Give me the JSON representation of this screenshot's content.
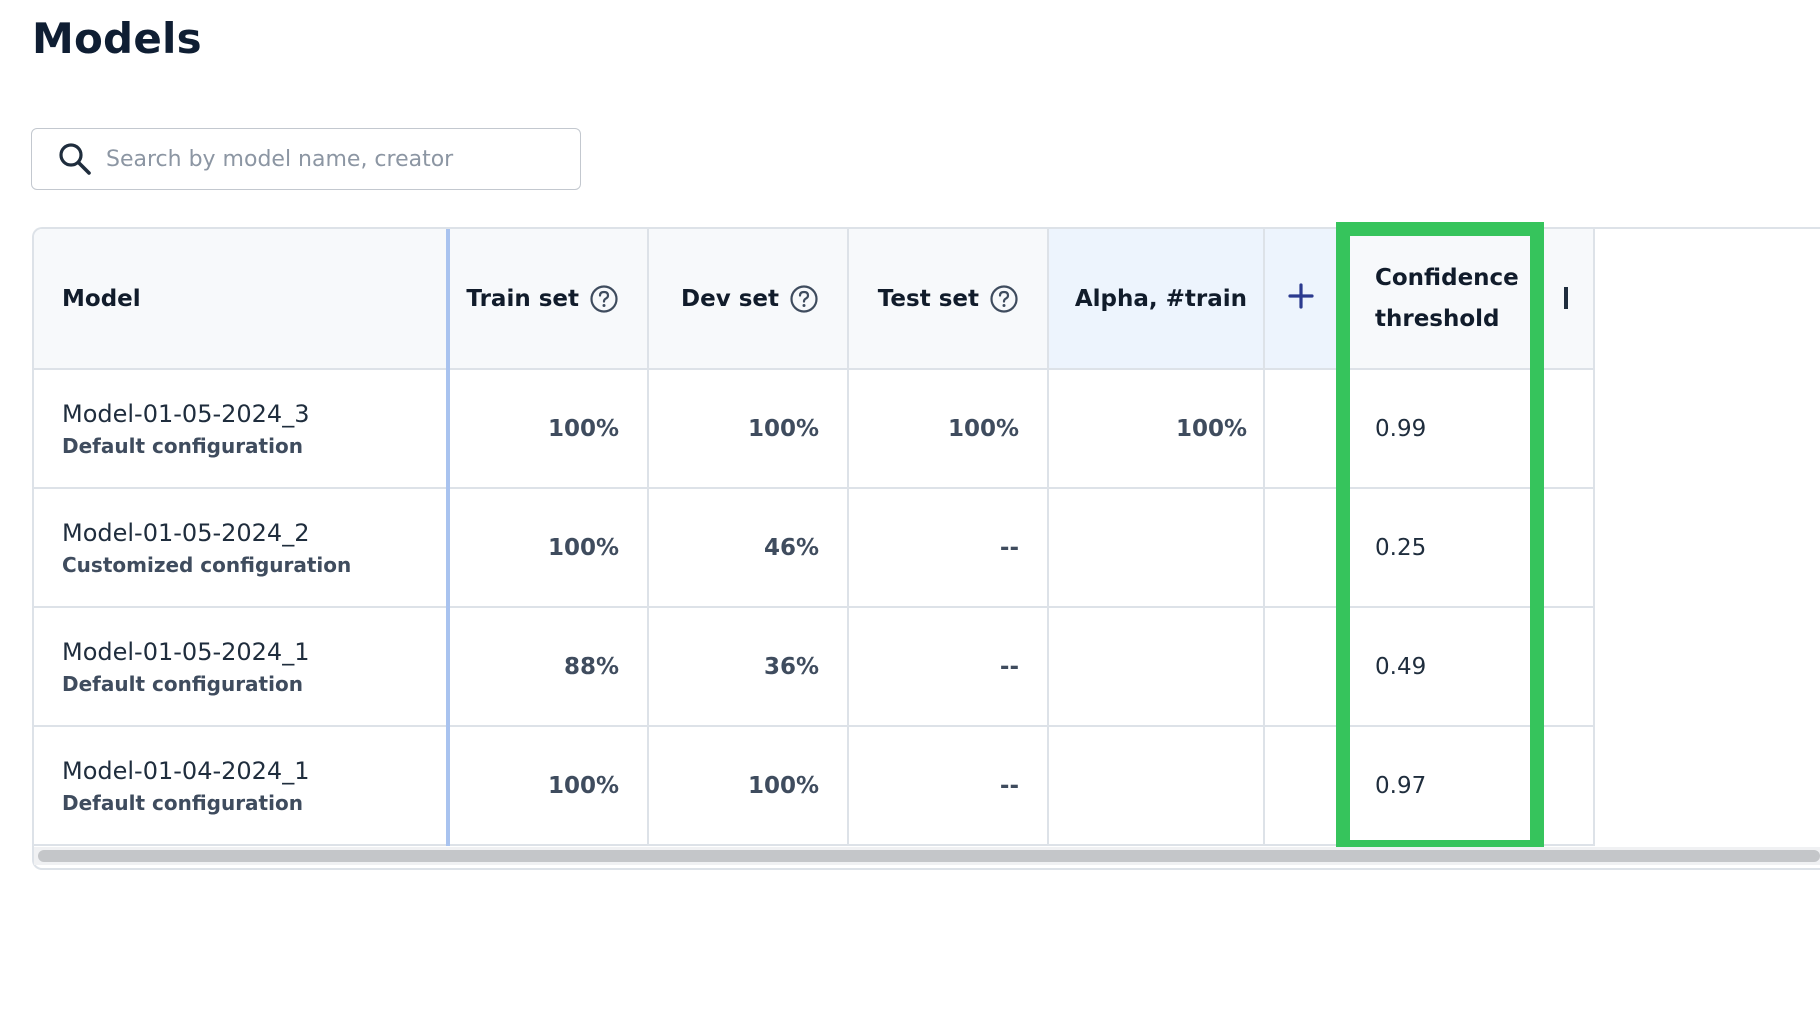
{
  "page": {
    "title": "Models"
  },
  "search": {
    "placeholder": "Search by model name, creator",
    "value": ""
  },
  "table": {
    "columns": {
      "model": "Model",
      "train_set": "Train set",
      "dev_set": "Dev set",
      "test_set": "Test set",
      "alpha": "Alpha, #train",
      "confidence_line1": "Confidence",
      "confidence_line2": "threshold"
    },
    "rows": [
      {
        "name": "Model-01-05-2024_3",
        "config": "Default configuration",
        "train": "100%",
        "dev": "100%",
        "test": "100%",
        "alpha": "100%",
        "confidence": "0.99"
      },
      {
        "name": "Model-01-05-2024_2",
        "config": "Customized configuration",
        "train": "100%",
        "dev": "46%",
        "test": "--",
        "alpha": "",
        "confidence": "0.25"
      },
      {
        "name": "Model-01-05-2024_1",
        "config": "Default configuration",
        "train": "88%",
        "dev": "36%",
        "test": "--",
        "alpha": "",
        "confidence": "0.49"
      },
      {
        "name": "Model-01-04-2024_1",
        "config": "Default configuration",
        "train": "100%",
        "dev": "100%",
        "test": "--",
        "alpha": "",
        "confidence": "0.97"
      }
    ]
  },
  "icons": {
    "search": "search-icon",
    "help": "question-circle-icon",
    "add": "plus-icon"
  },
  "colors": {
    "highlight": "#36c45c",
    "accent": "#2b3a8f",
    "header_bg": "#f7f9fb",
    "alpha_header_bg": "#edf4fd"
  }
}
